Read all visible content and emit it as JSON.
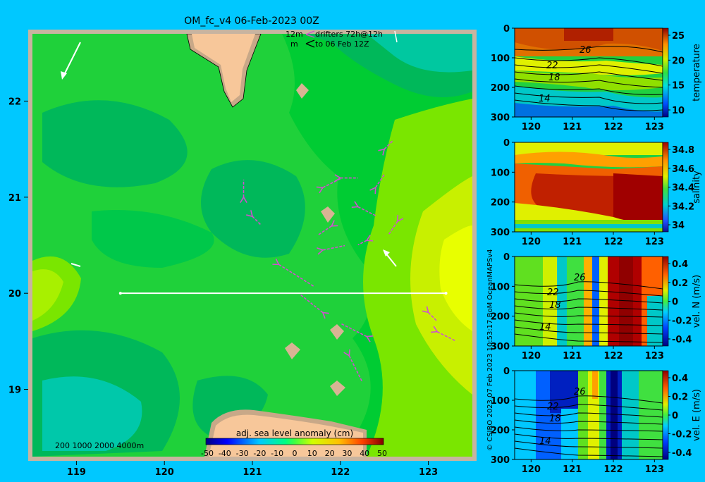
{
  "title": "OM_fc_v4  06-Feb-2023 00Z",
  "legend": {
    "drifter_line1_left": "12m",
    "drifter_line1_right": "drifters 72h@12h",
    "drifter_line2_left": "m",
    "drifter_line2_right": "to 06 Feb 12Z"
  },
  "depth_legend": "200  1000  2000  4000m",
  "colorbar": {
    "label": "adj. sea level anomaly (cm)",
    "ticks": [
      "-50",
      "-40",
      "-30",
      "-20",
      "-10",
      "0",
      "10",
      "20",
      "30",
      "40",
      "50"
    ]
  },
  "vertical_caption": "© CSIRO 2023   07 Feb 2023 10:53:17 BoM OceanMAPSv4",
  "colors": {
    "background": "#00c8ff",
    "frame": "#c8b4a0",
    "land": "#f7c79a",
    "section_line": "#ffffff",
    "drifter": "#d050d0"
  },
  "chart_data": [
    {
      "type": "heatmap",
      "name": "sea level anomaly map",
      "x_ticks": [
        "119",
        "120",
        "121",
        "122",
        "123"
      ],
      "y_ticks": [
        "22",
        "21",
        "20",
        "19"
      ],
      "xlim": [
        118.5,
        123.5
      ],
      "ylim": [
        18.3,
        22.7
      ],
      "section": {
        "lon_start": 119.5,
        "lon_end": 123.2,
        "lat": 20.0
      },
      "drifter_tracks": [
        {
          "lon": 121.3,
          "lat": 20.3,
          "dlon": 0.4,
          "dlat": -0.25
        },
        {
          "lon": 121.8,
          "lat": 19.8,
          "dlon": -0.25,
          "dlat": 0.2
        },
        {
          "lon": 122.3,
          "lat": 19.55,
          "dlon": -0.3,
          "dlat": 0.15
        },
        {
          "lon": 122.1,
          "lat": 19.35,
          "dlon": 0.15,
          "dlat": -0.3
        },
        {
          "lon": 121.9,
          "lat": 20.7,
          "dlon": -0.15,
          "dlat": -0.1
        },
        {
          "lon": 122.2,
          "lat": 20.9,
          "dlon": 0.2,
          "dlat": -0.1
        },
        {
          "lon": 122.4,
          "lat": 21.1,
          "dlon": 0.1,
          "dlat": 0.15
        },
        {
          "lon": 121.8,
          "lat": 20.45,
          "dlon": 0.25,
          "dlat": 0.05
        },
        {
          "lon": 121.8,
          "lat": 21.1,
          "dlon": 0.2,
          "dlat": 0.1
        },
        {
          "lon": 122.0,
          "lat": 21.2,
          "dlon": 0.2,
          "dlat": 0.0
        },
        {
          "lon": 121.0,
          "lat": 20.8,
          "dlon": 0.1,
          "dlat": -0.1
        },
        {
          "lon": 120.9,
          "lat": 21.0,
          "dlon": 0.0,
          "dlat": 0.2
        },
        {
          "lon": 122.5,
          "lat": 21.5,
          "dlon": 0.1,
          "dlat": 0.1
        },
        {
          "lon": 122.65,
          "lat": 20.75,
          "dlon": -0.1,
          "dlat": -0.15
        },
        {
          "lon": 123.0,
          "lat": 19.8,
          "dlon": 0.1,
          "dlat": -0.1
        },
        {
          "lon": 123.1,
          "lat": 19.6,
          "dlon": 0.2,
          "dlat": -0.1
        },
        {
          "lon": 122.3,
          "lat": 20.55,
          "dlon": -0.1,
          "dlat": -0.05
        }
      ]
    },
    {
      "type": "heatmap",
      "name": "temperature section",
      "cbar_label": "temperature",
      "x_ticks": [
        "120",
        "121",
        "122",
        "123"
      ],
      "y_ticks": [
        "0",
        "100",
        "200",
        "300"
      ],
      "cbar_ticks": [
        "25",
        "20",
        "15",
        "10"
      ],
      "contour_labels": [
        "26",
        "22",
        "18",
        "14"
      ]
    },
    {
      "type": "heatmap",
      "name": "salinity section",
      "cbar_label": "salinity",
      "x_ticks": [
        "120",
        "121",
        "122",
        "123"
      ],
      "y_ticks": [
        "0",
        "100",
        "200",
        "300"
      ],
      "cbar_ticks": [
        "34.8",
        "34.6",
        "34.4",
        "34.2",
        "34"
      ]
    },
    {
      "type": "heatmap",
      "name": "northward velocity section",
      "cbar_label": "vel. N (m/s)",
      "x_ticks": [
        "120",
        "121",
        "122",
        "123"
      ],
      "y_ticks": [
        "0",
        "100",
        "200",
        "300"
      ],
      "cbar_ticks": [
        "0.4",
        "0.2",
        "0",
        "-0.2",
        "-0.4"
      ],
      "contour_labels": [
        "26",
        "22",
        "18",
        "14"
      ]
    },
    {
      "type": "heatmap",
      "name": "eastward velocity section",
      "cbar_label": "vel. E (m/s)",
      "x_ticks": [
        "120",
        "121",
        "122",
        "123"
      ],
      "y_ticks": [
        "0",
        "100",
        "200",
        "300"
      ],
      "cbar_ticks": [
        "0.4",
        "0.2",
        "0",
        "-0.2",
        "-0.4"
      ],
      "contour_labels": [
        "26",
        "22",
        "18",
        "14"
      ]
    }
  ]
}
